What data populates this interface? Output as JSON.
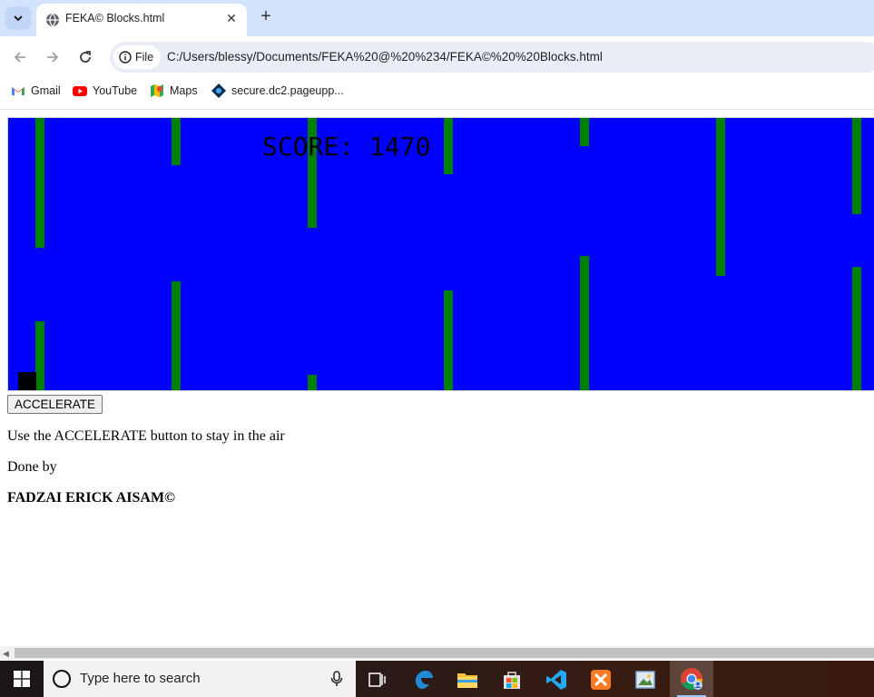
{
  "browser": {
    "tab": {
      "title": "FEKA©  Blocks.html",
      "close_glyph": "✕"
    },
    "new_tab_glyph": "+",
    "address": {
      "scheme_chip": "File",
      "url": "C:/Users/blessy/Documents/FEKA%20@%20%234/FEKA©%20%20Blocks.html"
    },
    "bookmarks": [
      {
        "label": "Gmail",
        "icon": "gmail-icon"
      },
      {
        "label": "YouTube",
        "icon": "youtube-icon"
      },
      {
        "label": "Maps",
        "icon": "maps-icon"
      },
      {
        "label": "secure.dc2.pageupp...",
        "icon": "pageup-icon"
      }
    ]
  },
  "game": {
    "score_label": "SCORE: 1470",
    "colors": {
      "background": "#0000ff",
      "obstacle": "#008000",
      "player": "#000000"
    }
  },
  "page": {
    "button_label": "ACCELERATE",
    "instructions": "Use the ACCELERATE button to stay in the air",
    "done_by": "Done by",
    "author": "FADZAI ERICK AISAM©"
  },
  "taskbar": {
    "search_placeholder": "Type here to search",
    "apps": [
      "task-view-icon",
      "edge-icon",
      "file-explorer-icon",
      "store-icon",
      "vscode-icon",
      "xampp-icon",
      "photo-viewer-icon",
      "chrome-icon"
    ]
  }
}
